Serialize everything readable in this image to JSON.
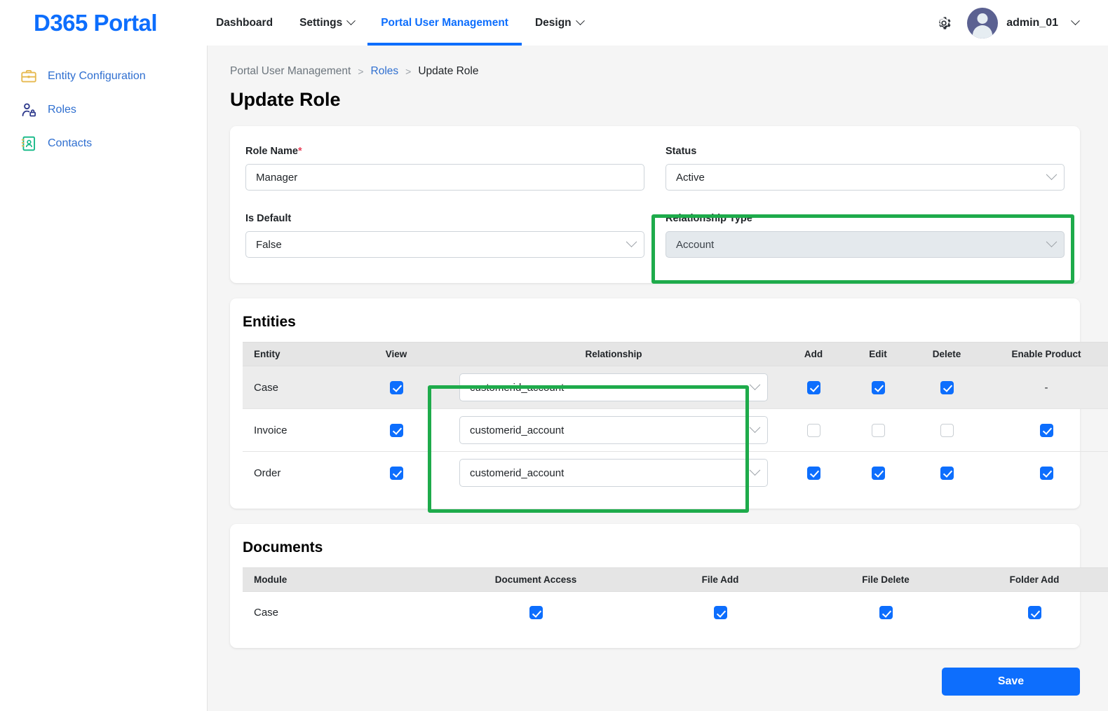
{
  "brand": "D365 Portal",
  "nav": {
    "tabs": [
      {
        "label": "Dashboard",
        "has_caret": false,
        "active": false
      },
      {
        "label": "Settings",
        "has_caret": true,
        "active": false
      },
      {
        "label": "Portal User Management",
        "has_caret": false,
        "active": true
      },
      {
        "label": "Design",
        "has_caret": true,
        "active": false
      }
    ],
    "gear_icon": "gear-icon",
    "user": {
      "name": "admin_01",
      "avatar_icon": "user-avatar-icon"
    }
  },
  "sidebar": {
    "items": [
      {
        "label": "Entity Configuration",
        "icon": "briefcase-icon",
        "color": "#e6b94f"
      },
      {
        "label": "Roles",
        "icon": "user-lock-icon",
        "color": "#2e3a8c"
      },
      {
        "label": "Contacts",
        "icon": "contact-card-icon",
        "color": "#12b886"
      }
    ]
  },
  "breadcrumb": {
    "root": "Portal User Management",
    "parent": "Roles",
    "current": "Update Role",
    "separator": ">"
  },
  "page_title": "Update Role",
  "form": {
    "role_name": {
      "label": "Role Name",
      "required_mark": "*",
      "value": "Manager",
      "placeholder": "Role Name"
    },
    "status": {
      "label": "Status",
      "value": "Active"
    },
    "is_default": {
      "label": "Is Default",
      "value": "False"
    },
    "relationship_type": {
      "label": "Relationship Type",
      "value": "Account",
      "disabled": true,
      "highlighted": true
    }
  },
  "entities": {
    "title": "Entities",
    "columns": [
      "Entity",
      "View",
      "Relationship",
      "Add",
      "Edit",
      "Delete",
      "Enable Product"
    ],
    "rows": [
      {
        "entity": "Case",
        "view": true,
        "relationship": "customerid_account",
        "add": true,
        "edit": true,
        "delete": true,
        "enable_product": "-",
        "shaded": true
      },
      {
        "entity": "Invoice",
        "view": true,
        "relationship": "customerid_account",
        "add": false,
        "edit": false,
        "delete": false,
        "enable_product": true,
        "shaded": false
      },
      {
        "entity": "Order",
        "view": true,
        "relationship": "customerid_account",
        "add": true,
        "edit": true,
        "delete": true,
        "enable_product": true,
        "shaded": false
      }
    ]
  },
  "documents": {
    "title": "Documents",
    "columns": [
      "Module",
      "Document Access",
      "File Add",
      "File Delete",
      "Folder Add"
    ],
    "rows": [
      {
        "module": "Case",
        "document_access": true,
        "file_add": true,
        "file_delete": true,
        "folder_add": true
      }
    ]
  },
  "actions": {
    "save_label": "Save"
  },
  "colors": {
    "accent_blue": "#0d6efd",
    "link_blue": "#2f6fd0",
    "highlight_green": "#1eab4b",
    "page_bg": "#f5f5f5",
    "table_header_bg": "#e5e5e5",
    "shaded_row_bg": "#ececec",
    "required_red": "#e8415a"
  }
}
